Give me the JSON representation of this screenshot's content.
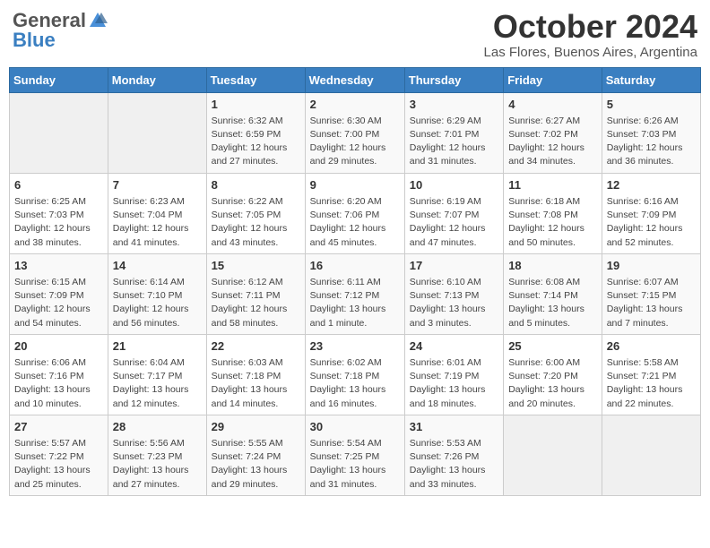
{
  "logo": {
    "general": "General",
    "blue": "Blue"
  },
  "title": "October 2024",
  "location": "Las Flores, Buenos Aires, Argentina",
  "days_of_week": [
    "Sunday",
    "Monday",
    "Tuesday",
    "Wednesday",
    "Thursday",
    "Friday",
    "Saturday"
  ],
  "weeks": [
    [
      {
        "day": "",
        "info": ""
      },
      {
        "day": "",
        "info": ""
      },
      {
        "day": "1",
        "info": "Sunrise: 6:32 AM\nSunset: 6:59 PM\nDaylight: 12 hours and 27 minutes."
      },
      {
        "day": "2",
        "info": "Sunrise: 6:30 AM\nSunset: 7:00 PM\nDaylight: 12 hours and 29 minutes."
      },
      {
        "day": "3",
        "info": "Sunrise: 6:29 AM\nSunset: 7:01 PM\nDaylight: 12 hours and 31 minutes."
      },
      {
        "day": "4",
        "info": "Sunrise: 6:27 AM\nSunset: 7:02 PM\nDaylight: 12 hours and 34 minutes."
      },
      {
        "day": "5",
        "info": "Sunrise: 6:26 AM\nSunset: 7:03 PM\nDaylight: 12 hours and 36 minutes."
      }
    ],
    [
      {
        "day": "6",
        "info": "Sunrise: 6:25 AM\nSunset: 7:03 PM\nDaylight: 12 hours and 38 minutes."
      },
      {
        "day": "7",
        "info": "Sunrise: 6:23 AM\nSunset: 7:04 PM\nDaylight: 12 hours and 41 minutes."
      },
      {
        "day": "8",
        "info": "Sunrise: 6:22 AM\nSunset: 7:05 PM\nDaylight: 12 hours and 43 minutes."
      },
      {
        "day": "9",
        "info": "Sunrise: 6:20 AM\nSunset: 7:06 PM\nDaylight: 12 hours and 45 minutes."
      },
      {
        "day": "10",
        "info": "Sunrise: 6:19 AM\nSunset: 7:07 PM\nDaylight: 12 hours and 47 minutes."
      },
      {
        "day": "11",
        "info": "Sunrise: 6:18 AM\nSunset: 7:08 PM\nDaylight: 12 hours and 50 minutes."
      },
      {
        "day": "12",
        "info": "Sunrise: 6:16 AM\nSunset: 7:09 PM\nDaylight: 12 hours and 52 minutes."
      }
    ],
    [
      {
        "day": "13",
        "info": "Sunrise: 6:15 AM\nSunset: 7:09 PM\nDaylight: 12 hours and 54 minutes."
      },
      {
        "day": "14",
        "info": "Sunrise: 6:14 AM\nSunset: 7:10 PM\nDaylight: 12 hours and 56 minutes."
      },
      {
        "day": "15",
        "info": "Sunrise: 6:12 AM\nSunset: 7:11 PM\nDaylight: 12 hours and 58 minutes."
      },
      {
        "day": "16",
        "info": "Sunrise: 6:11 AM\nSunset: 7:12 PM\nDaylight: 13 hours and 1 minute."
      },
      {
        "day": "17",
        "info": "Sunrise: 6:10 AM\nSunset: 7:13 PM\nDaylight: 13 hours and 3 minutes."
      },
      {
        "day": "18",
        "info": "Sunrise: 6:08 AM\nSunset: 7:14 PM\nDaylight: 13 hours and 5 minutes."
      },
      {
        "day": "19",
        "info": "Sunrise: 6:07 AM\nSunset: 7:15 PM\nDaylight: 13 hours and 7 minutes."
      }
    ],
    [
      {
        "day": "20",
        "info": "Sunrise: 6:06 AM\nSunset: 7:16 PM\nDaylight: 13 hours and 10 minutes."
      },
      {
        "day": "21",
        "info": "Sunrise: 6:04 AM\nSunset: 7:17 PM\nDaylight: 13 hours and 12 minutes."
      },
      {
        "day": "22",
        "info": "Sunrise: 6:03 AM\nSunset: 7:18 PM\nDaylight: 13 hours and 14 minutes."
      },
      {
        "day": "23",
        "info": "Sunrise: 6:02 AM\nSunset: 7:18 PM\nDaylight: 13 hours and 16 minutes."
      },
      {
        "day": "24",
        "info": "Sunrise: 6:01 AM\nSunset: 7:19 PM\nDaylight: 13 hours and 18 minutes."
      },
      {
        "day": "25",
        "info": "Sunrise: 6:00 AM\nSunset: 7:20 PM\nDaylight: 13 hours and 20 minutes."
      },
      {
        "day": "26",
        "info": "Sunrise: 5:58 AM\nSunset: 7:21 PM\nDaylight: 13 hours and 22 minutes."
      }
    ],
    [
      {
        "day": "27",
        "info": "Sunrise: 5:57 AM\nSunset: 7:22 PM\nDaylight: 13 hours and 25 minutes."
      },
      {
        "day": "28",
        "info": "Sunrise: 5:56 AM\nSunset: 7:23 PM\nDaylight: 13 hours and 27 minutes."
      },
      {
        "day": "29",
        "info": "Sunrise: 5:55 AM\nSunset: 7:24 PM\nDaylight: 13 hours and 29 minutes."
      },
      {
        "day": "30",
        "info": "Sunrise: 5:54 AM\nSunset: 7:25 PM\nDaylight: 13 hours and 31 minutes."
      },
      {
        "day": "31",
        "info": "Sunrise: 5:53 AM\nSunset: 7:26 PM\nDaylight: 13 hours and 33 minutes."
      },
      {
        "day": "",
        "info": ""
      },
      {
        "day": "",
        "info": ""
      }
    ]
  ]
}
